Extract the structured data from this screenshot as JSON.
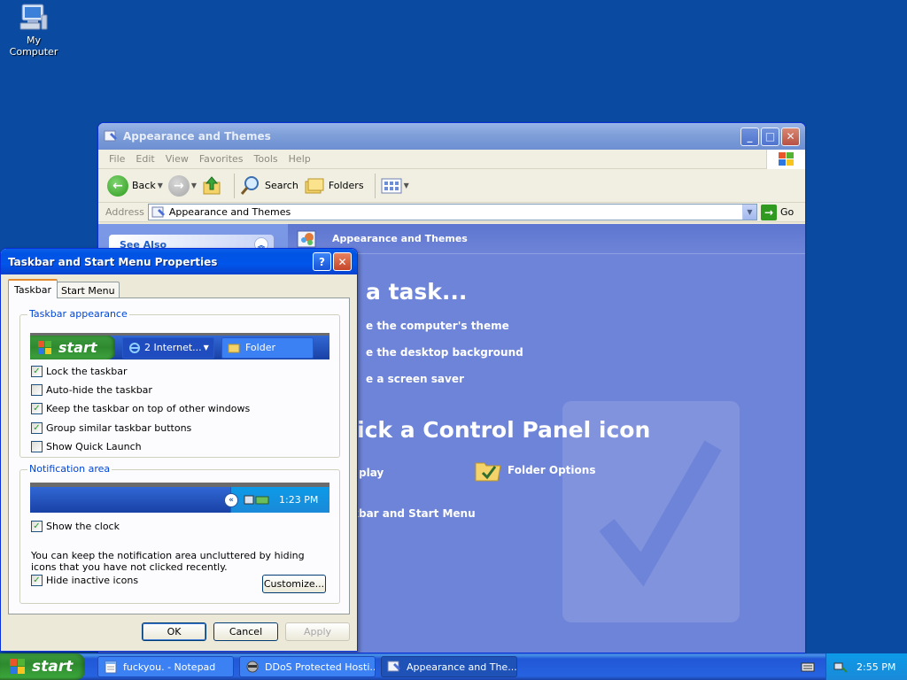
{
  "desktop": {
    "icons": [
      {
        "label": "My Computer",
        "icon": "my-computer-icon"
      }
    ]
  },
  "explorer": {
    "title": "Appearance and Themes",
    "menu": [
      "File",
      "Edit",
      "View",
      "Favorites",
      "Tools",
      "Help"
    ],
    "toolbar": {
      "back": "Back",
      "search": "Search",
      "folders": "Folders"
    },
    "address": {
      "label": "Address",
      "value": "Appearance and Themes",
      "go": "Go"
    },
    "sidebar": {
      "see_also": "See Also"
    },
    "main": {
      "header": "Appearance and Themes",
      "pick_task": "a task...",
      "tasks": [
        "e the computer's theme",
        "e the desktop background",
        "e a screen saver"
      ],
      "pick_icon": "ick a Control Panel icon",
      "icons": [
        {
          "label": "play"
        },
        {
          "label": "Folder Options"
        },
        {
          "label": "kbar and Start Menu"
        }
      ]
    }
  },
  "dialog": {
    "title": "Taskbar and Start Menu Properties",
    "tabs": [
      "Taskbar",
      "Start Menu"
    ],
    "appearance": {
      "legend": "Taskbar appearance",
      "preview": {
        "start": "start",
        "button1": "2 Internet...",
        "button2": "Folder"
      },
      "options": [
        {
          "label": "Lock the taskbar",
          "checked": true
        },
        {
          "label": "Auto-hide the taskbar",
          "checked": false
        },
        {
          "label": "Keep the taskbar on top of other windows",
          "checked": true
        },
        {
          "label": "Group similar taskbar buttons",
          "checked": true
        },
        {
          "label": "Show Quick Launch",
          "checked": false
        }
      ]
    },
    "notification": {
      "legend": "Notification area",
      "preview_time": "1:23 PM",
      "show_clock": {
        "label": "Show the clock",
        "checked": true
      },
      "help_text": "You can keep the notification area uncluttered by hiding icons that you have not clicked recently.",
      "hide_inactive": {
        "label": "Hide inactive icons",
        "checked": true
      },
      "customize": "Customize..."
    },
    "buttons": {
      "ok": "OK",
      "cancel": "Cancel",
      "apply": "Apply"
    }
  },
  "taskbar": {
    "start": "start",
    "tasks": [
      {
        "label": "fuckyou. - Notepad",
        "active": false
      },
      {
        "label": "DDoS Protected Hosti...",
        "active": false
      },
      {
        "label": "Appearance and The...",
        "active": true
      }
    ],
    "clock": "2:55 PM"
  },
  "colors": {
    "desktop": "#0a4aa0",
    "title_active": "#0054e3",
    "taskbar": "#2663e0",
    "start_green": "#3c9a3c",
    "groupbox_legend": "#0046d5"
  }
}
